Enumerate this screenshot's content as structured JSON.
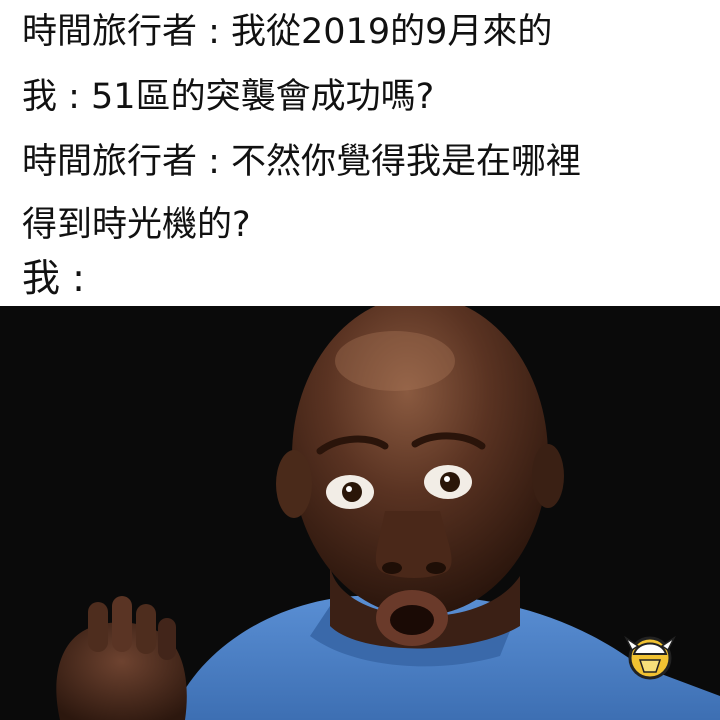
{
  "caption": {
    "lines": [
      "時間旅行者 : 我從2019的9月來的",
      "我 : 51區的突襲會成功嗎?",
      "時間旅行者 : 不然你覺得我是在哪裡",
      "得到時光機的?",
      "我 :"
    ]
  },
  "photo": {
    "background": "#0a0a0a",
    "skin": "#5a3322",
    "shirt": "#4d82c8"
  },
  "logo": {
    "icon": "viking-helmet-icon",
    "color": "#f1c232"
  }
}
